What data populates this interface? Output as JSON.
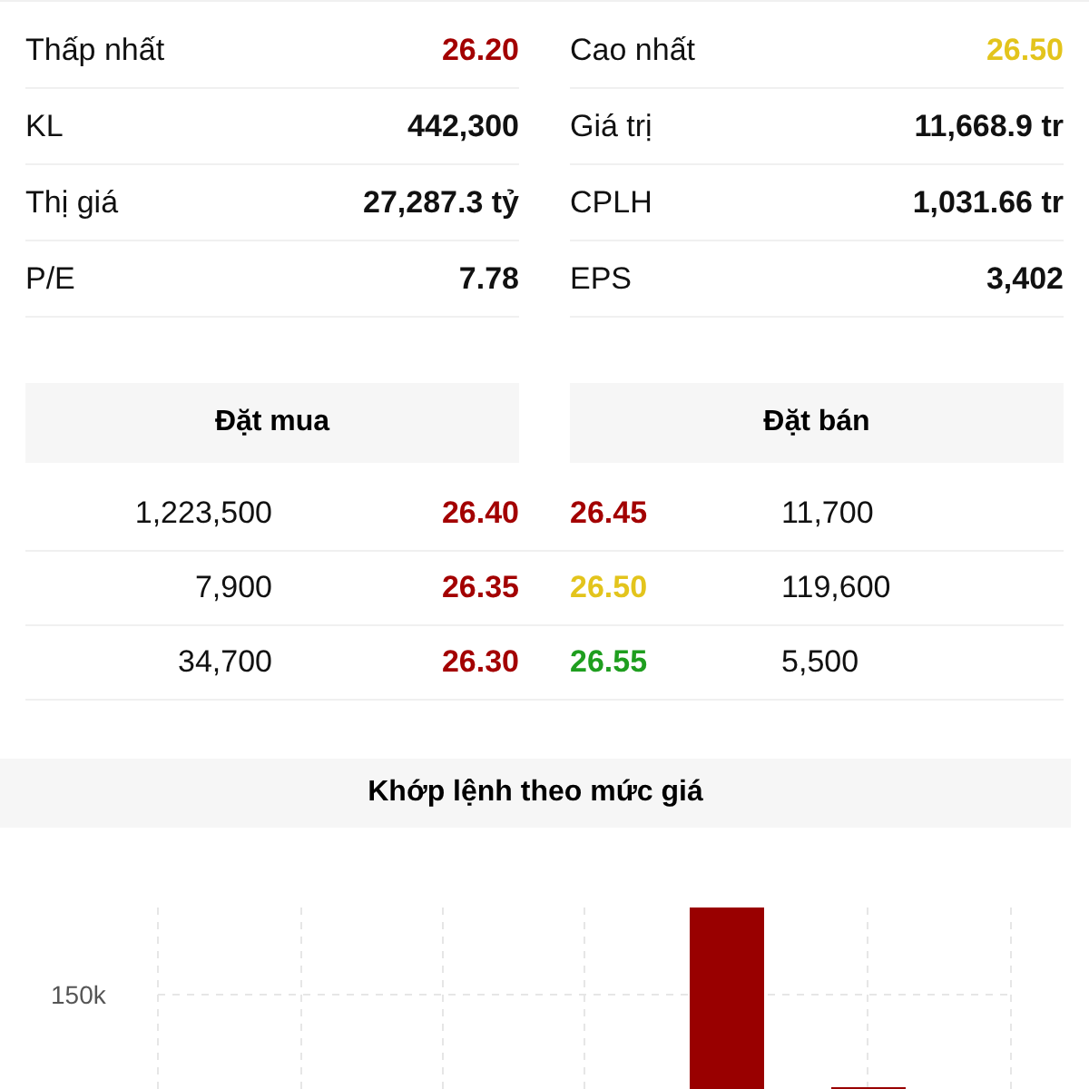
{
  "stats": [
    {
      "label": "Thấp nhất",
      "value": "26.20",
      "color": "#a30000"
    },
    {
      "label": "Cao nhất",
      "value": "26.50",
      "color": "#e3c41c"
    },
    {
      "label": "KL",
      "value": "442,300"
    },
    {
      "label": "Giá trị",
      "value": "11,668.9 tr"
    },
    {
      "label": "Thị giá",
      "value": "27,287.3 tỷ"
    },
    {
      "label": "CPLH",
      "value": "1,031.66 tr"
    },
    {
      "label": "P/E",
      "value": "7.78"
    },
    {
      "label": "EPS",
      "value": "3,402"
    }
  ],
  "order_book": {
    "buy_title": "Đặt mua",
    "sell_title": "Đặt bán",
    "rows": [
      {
        "buy": {
          "volume": "1,223,500",
          "price": "26.40",
          "color": "#a30000"
        },
        "sell": {
          "price": "26.45",
          "color": "#a30000",
          "volume": "11,700"
        }
      },
      {
        "buy": {
          "volume": "7,900",
          "price": "26.35",
          "color": "#a30000"
        },
        "sell": {
          "price": "26.50",
          "color": "#e3c41c",
          "volume": "119,600"
        }
      },
      {
        "buy": {
          "volume": "34,700",
          "price": "26.30",
          "color": "#a30000"
        },
        "sell": {
          "price": "26.55",
          "color": "#1f9e1f",
          "volume": "5,500"
        }
      }
    ]
  },
  "chart": {
    "title": "Khớp lệnh theo mức giá",
    "ytick_label": "150k"
  }
}
